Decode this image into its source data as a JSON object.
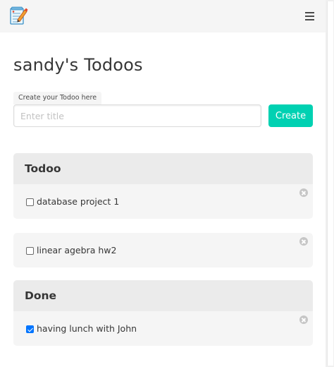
{
  "app": {
    "logo_icon": "notepad-pencil-logo-icon",
    "menu_icon": "hamburger-menu-icon"
  },
  "page": {
    "title": "sandy's Todoos"
  },
  "create_form": {
    "tag_label": "Create your Todoo here",
    "input_value": "",
    "input_placeholder": "Enter title",
    "button_label": "Create",
    "button_color": "#00d1b2"
  },
  "todo_section": {
    "heading": "Todoo",
    "items": [
      {
        "label": "database project 1",
        "checked": false,
        "delete_icon": "close-circle-icon"
      },
      {
        "label": "linear agebra hw2",
        "checked": false,
        "delete_icon": "close-circle-icon"
      }
    ]
  },
  "done_section": {
    "heading": "Done",
    "items": [
      {
        "label": "having lunch with John",
        "checked": true,
        "delete_icon": "close-circle-icon"
      }
    ]
  },
  "colors": {
    "panel_heading_bg": "#ebebeb",
    "panel_block_bg": "#f5f5f5",
    "navbar_bg": "#f5f5f5",
    "checkbox_checked": "#0075ff"
  }
}
